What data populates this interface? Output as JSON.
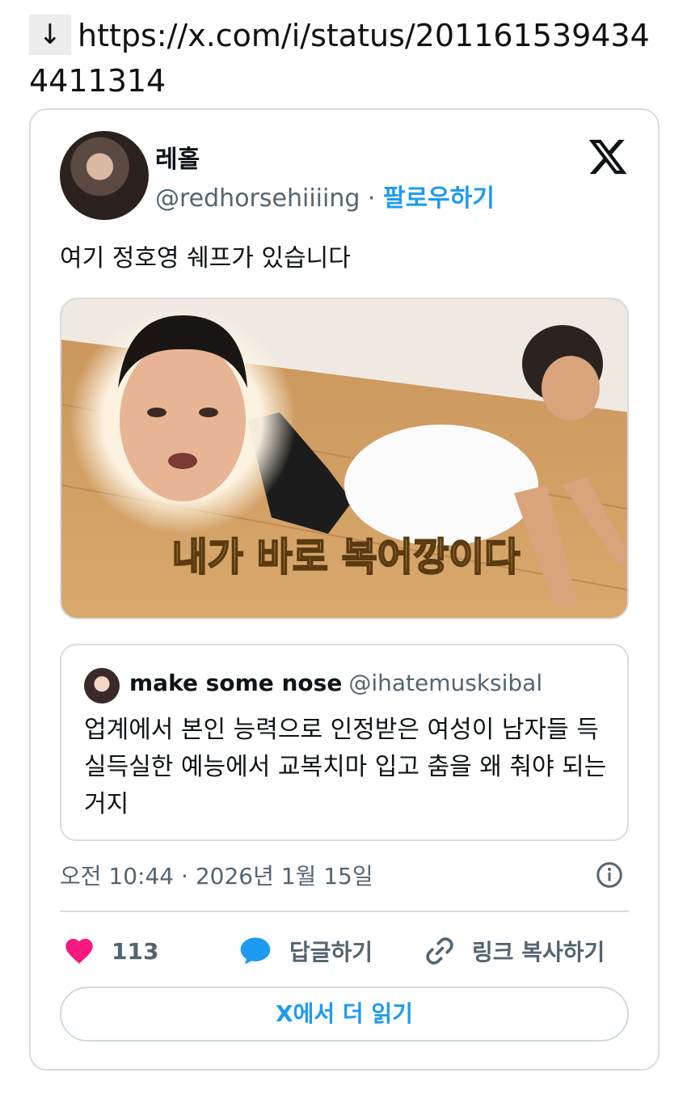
{
  "link": {
    "arrow": "↓",
    "url": "https://x.com/i/status/2011615394344411314"
  },
  "tweet": {
    "display_name": "레홀",
    "handle": "@redhorsehiiiing",
    "separator": " · ",
    "follow_label": "팔로우하기",
    "text": "여기 정호영 쉐프가 있습니다",
    "media_caption": "내가 바로 복어깡이다",
    "timestamp": "오전 10:44 · 2026년 1월 15일"
  },
  "quote": {
    "name": "make some nose",
    "handle": "@ihatemusksibal",
    "text": "업계에서 본인 능력으로 인정받은 여성이 남자들 득실득실한 예능에서 교복치마 입고 춤을 왜 춰야 되는 거지"
  },
  "actions": {
    "likes": "113",
    "reply_label": "답글하기",
    "copy_link_label": "링크 복사하기",
    "read_more_label": "X에서 더 읽기"
  },
  "icons": {
    "logo": "x-logo-icon",
    "like": "heart-icon",
    "reply": "speech-bubble-icon",
    "copy_link": "link-icon",
    "info": "info-icon"
  },
  "colors": {
    "accent": "#1d9bf0",
    "like": "#f91880",
    "muted": "#536471",
    "border": "#d6dde2"
  }
}
